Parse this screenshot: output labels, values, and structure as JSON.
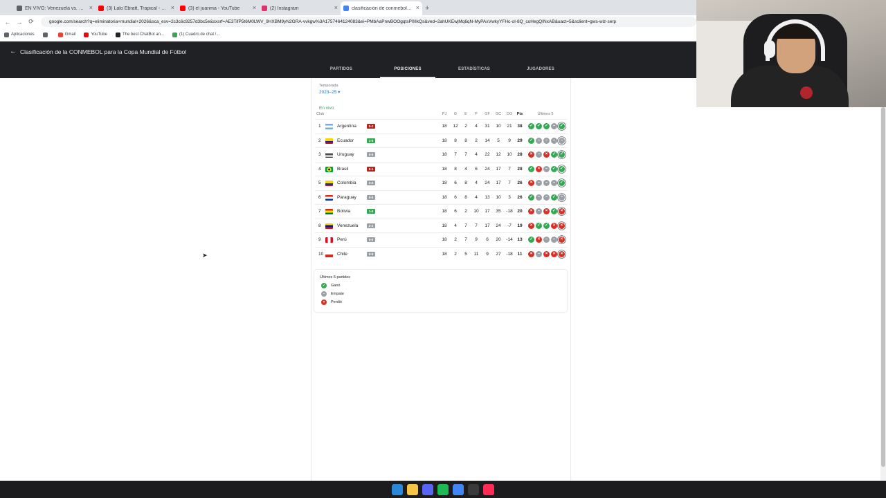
{
  "browser": {
    "tabs": [
      {
        "label": "EN VIVO: Venezuela vs. Colombia",
        "active": false,
        "icon": "globe-icon",
        "color": "#5f6368"
      },
      {
        "label": "(3) Lalo Ebratt, Trapical - Mocca",
        "active": false,
        "icon": "youtube-icon",
        "color": "#ff0000"
      },
      {
        "label": "(3) el juanma - YouTube",
        "active": false,
        "icon": "youtube-icon",
        "color": "#ff0000"
      },
      {
        "label": "(2) Instagram",
        "active": false,
        "icon": "instagram-icon",
        "color": "#e1306c"
      },
      {
        "label": "clasificación de conmebol para",
        "active": true,
        "icon": "google-icon",
        "color": "#4285f4"
      }
    ],
    "url": "google.com/search?q=eliminatoria+mundial+2026&sca_esv=2c3c6c9257d3bc5e&sxsrf=AE3TifP5t6M0LWV_9HXBM9yN2GRA-vvkgw%3A1757464124083&ei=PMbAaPnwBOOgqtsP0lIkQs&ved=2ahUKEwjMq6qN-MyPAxVwkyYFHc-oI-8Q_coHegQINxAB&uact=5&sclient=gws-wiz-serp",
    "bookmarks": [
      {
        "label": "Aplicaciones",
        "icon": "apps-icon",
        "color": "#5f6368"
      },
      {
        "label": "",
        "icon": "grid-icon",
        "color": "#5f6368"
      },
      {
        "label": "Gmail",
        "icon": "gmail-icon",
        "color": "#ea4335"
      },
      {
        "label": "YouTube",
        "icon": "youtube-icon",
        "color": "#ff0000"
      },
      {
        "label": "The best ChatBot an...",
        "icon": "chatbot-icon",
        "color": "#202124"
      },
      {
        "label": "(1) Cuadro de chat /...",
        "icon": "chat-icon",
        "color": "#34a853"
      }
    ]
  },
  "header": {
    "title": "Clasificación de la CONMEBOL para la Copa Mundial de Fútbol",
    "tabs": [
      {
        "label": "PARTIDOS",
        "active": false
      },
      {
        "label": "POSICIONES",
        "active": true
      },
      {
        "label": "ESTADÍSTICAS",
        "active": false
      },
      {
        "label": "JUGADORES",
        "active": false
      }
    ]
  },
  "standings": {
    "season_label": "Temporada",
    "season_value": "2023–25 ▾",
    "live_label": "En vivo",
    "club_header": "Club",
    "columns": [
      "PJ",
      "G",
      "E",
      "P",
      "GF",
      "GC",
      "DG",
      "Pts"
    ],
    "last5_header": "Últimos 5",
    "rows": [
      {
        "pos": "1",
        "team": "Argentina",
        "flag": "argentina",
        "score": "0-1",
        "score_color": "#b3261e",
        "stats": [
          "18",
          "12",
          "2",
          "4",
          "31",
          "10",
          "21",
          "38"
        ],
        "form": [
          "w",
          "w",
          "w",
          "d",
          "w"
        ]
      },
      {
        "pos": "2",
        "team": "Ecuador",
        "flag": "ecuador",
        "score": "1-0",
        "score_color": "#34a853",
        "stats": [
          "18",
          "8",
          "8",
          "2",
          "14",
          "5",
          "9",
          "29"
        ],
        "form": [
          "w",
          "d",
          "d",
          "d",
          "d"
        ]
      },
      {
        "pos": "3",
        "team": "Uruguay",
        "flag": "uruguay",
        "score": "0-0",
        "score_color": "#9aa0a6",
        "stats": [
          "18",
          "7",
          "7",
          "4",
          "22",
          "12",
          "10",
          "28"
        ],
        "form": [
          "l",
          "d",
          "l",
          "w",
          "w"
        ]
      },
      {
        "pos": "4",
        "team": "Brasil",
        "flag": "brasil",
        "score": "0-1",
        "score_color": "#b3261e",
        "stats": [
          "18",
          "8",
          "4",
          "6",
          "24",
          "17",
          "7",
          "28"
        ],
        "form": [
          "w",
          "l",
          "d",
          "w",
          "w"
        ]
      },
      {
        "pos": "5",
        "team": "Colombia",
        "flag": "colombia",
        "score": "2-2",
        "score_color": "#9aa0a6",
        "stats": [
          "18",
          "6",
          "8",
          "4",
          "24",
          "17",
          "7",
          "26"
        ],
        "form": [
          "l",
          "d",
          "d",
          "d",
          "w"
        ]
      },
      {
        "pos": "6",
        "team": "Paraguay",
        "flag": "paraguay",
        "score": "0-0",
        "score_color": "#9aa0a6",
        "stats": [
          "18",
          "6",
          "8",
          "4",
          "13",
          "10",
          "3",
          "26"
        ],
        "form": [
          "w",
          "d",
          "d",
          "w",
          "d"
        ]
      },
      {
        "pos": "7",
        "team": "Bolivia",
        "flag": "bolivia",
        "score": "1-0",
        "score_color": "#34a853",
        "stats": [
          "18",
          "6",
          "2",
          "10",
          "17",
          "35",
          "-18",
          "20"
        ],
        "form": [
          "l",
          "d",
          "l",
          "w",
          "l"
        ]
      },
      {
        "pos": "8",
        "team": "Venezuela",
        "flag": "venezuela",
        "score": "2-2",
        "score_color": "#9aa0a6",
        "stats": [
          "18",
          "4",
          "7",
          "7",
          "17",
          "24",
          "-7",
          "19"
        ],
        "form": [
          "l",
          "w",
          "w",
          "l",
          "l"
        ]
      },
      {
        "pos": "9",
        "team": "Perú",
        "flag": "peru",
        "score": "0-0",
        "score_color": "#9aa0a6",
        "stats": [
          "18",
          "2",
          "7",
          "9",
          "6",
          "20",
          "-14",
          "13"
        ],
        "form": [
          "w",
          "l",
          "d",
          "d",
          "l"
        ]
      },
      {
        "pos": "10",
        "team": "Chile",
        "flag": "chile",
        "score": "0-0",
        "score_color": "#9aa0a6",
        "stats": [
          "18",
          "2",
          "5",
          "11",
          "9",
          "27",
          "-18",
          "11"
        ],
        "form": [
          "l",
          "d",
          "l",
          "l",
          "l"
        ]
      }
    ],
    "legend": {
      "title": "Últimos 5 partidos",
      "items": [
        {
          "label": "Ganó",
          "type": "w"
        },
        {
          "label": "Empate",
          "type": "d"
        },
        {
          "label": "Perdió",
          "type": "l"
        }
      ]
    }
  },
  "taskbar": {
    "icons": [
      {
        "name": "windows-start-icon",
        "color": "#2b88d8"
      },
      {
        "name": "file-explorer-icon",
        "color": "#f6c445"
      },
      {
        "name": "discord-icon",
        "color": "#5865f2"
      },
      {
        "name": "spotify-icon",
        "color": "#1db954"
      },
      {
        "name": "chrome-icon",
        "color": "#4285f4"
      },
      {
        "name": "obs-icon",
        "color": "#3a3a3a"
      },
      {
        "name": "tiktok-icon",
        "color": "#fe2c55"
      }
    ]
  }
}
